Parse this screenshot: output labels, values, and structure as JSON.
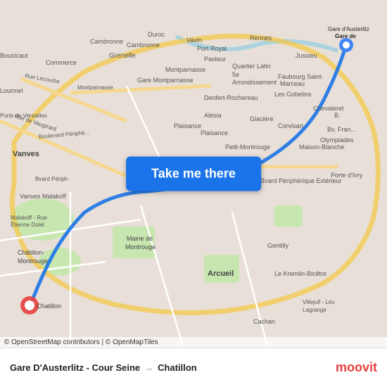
{
  "map": {
    "take_me_there_label": "Take me there",
    "attribution": "© OpenStreetMap contributors | © OpenMapTiles"
  },
  "footer": {
    "from": "Gare D'Austerlitz - Cour Seine",
    "arrow": "→",
    "to": "Chatillon",
    "moovit": "moovit"
  }
}
